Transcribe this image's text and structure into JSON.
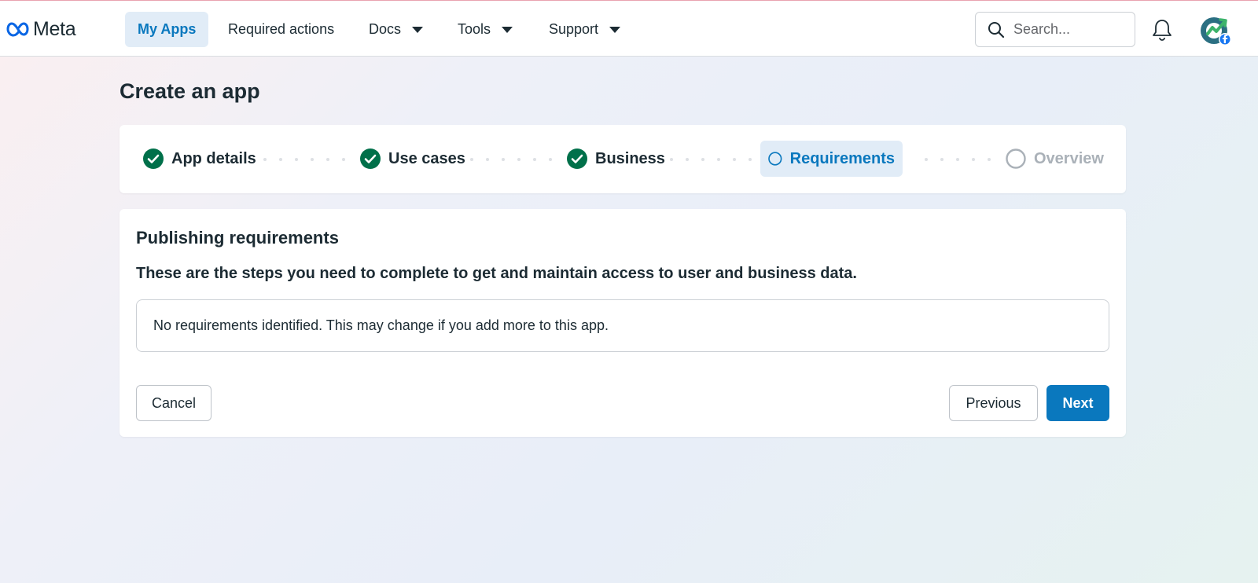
{
  "app": {
    "logo_text": "Meta",
    "accent_color": "#0a78be",
    "success_color": "#00704a"
  },
  "nav": {
    "items": [
      {
        "label": "My Apps",
        "active": true,
        "dropdown": false
      },
      {
        "label": "Required actions",
        "active": false,
        "dropdown": false
      },
      {
        "label": "Docs",
        "active": false,
        "dropdown": true
      },
      {
        "label": "Tools",
        "active": false,
        "dropdown": true
      },
      {
        "label": "Support",
        "active": false,
        "dropdown": true
      }
    ],
    "search_placeholder": "Search...",
    "icons": [
      "search-icon",
      "bell-icon",
      "avatar"
    ]
  },
  "page": {
    "title": "Create an app"
  },
  "stepper": {
    "steps": [
      {
        "label": "App details",
        "status": "complete"
      },
      {
        "label": "Use cases",
        "status": "complete"
      },
      {
        "label": "Business",
        "status": "complete"
      },
      {
        "label": "Requirements",
        "status": "current"
      },
      {
        "label": "Overview",
        "status": "pending"
      }
    ]
  },
  "requirements": {
    "title": "Publishing requirements",
    "description": "These are the steps you need to complete to get and maintain access to user and business data.",
    "empty_message": "No requirements identified. This may change if you add more to this app."
  },
  "actions": {
    "cancel_label": "Cancel",
    "previous_label": "Previous",
    "next_label": "Next"
  }
}
